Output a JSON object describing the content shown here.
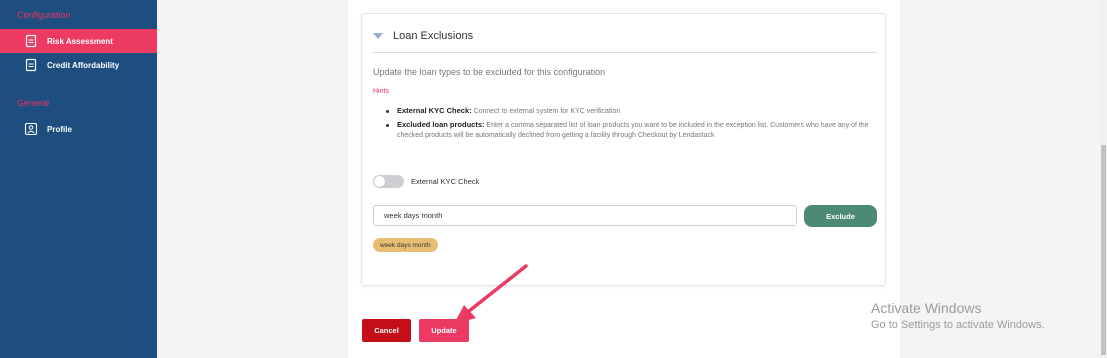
{
  "sidebar": {
    "configuration_title": "Configuration",
    "items": [
      {
        "label": "Risk Assessment",
        "icon": "document-icon",
        "active": true
      },
      {
        "label": "Credit Affordability",
        "icon": "document-icon",
        "active": false
      }
    ],
    "general_title": "General",
    "general_items": [
      {
        "label": "Profile",
        "icon": "profile-icon"
      }
    ]
  },
  "card": {
    "title": "Loan Exclusions",
    "description": "Update the loan types to be excluded for this configuration",
    "hints_title": "Hints",
    "hints": [
      {
        "term": "External KYC Check:",
        "text": " Connect to external system for KYC verification"
      },
      {
        "term": "Excluded loan products:",
        "text": " Enter a comma separated list of loan products you want to be included in the exception list. Customers who have any of the checked products will be automatically declined from getting a facility through Checkout by Lendastack"
      }
    ],
    "toggle_label": "External KYC Check",
    "toggle_on": false,
    "input_value": "week days month",
    "exclude_label": "Exclude",
    "tags": [
      "week days month"
    ]
  },
  "actions": {
    "cancel_label": "Cancel",
    "update_label": "Update"
  },
  "watermark": {
    "line1": "Activate Windows",
    "line2": "Go to Settings to activate Windows."
  },
  "colors": {
    "sidebar_bg": "#1e4e80",
    "accent": "#ec3a62",
    "exclude_button": "#4d8a76",
    "tag": "#e7bd72",
    "cancel_button": "#c40f18"
  }
}
